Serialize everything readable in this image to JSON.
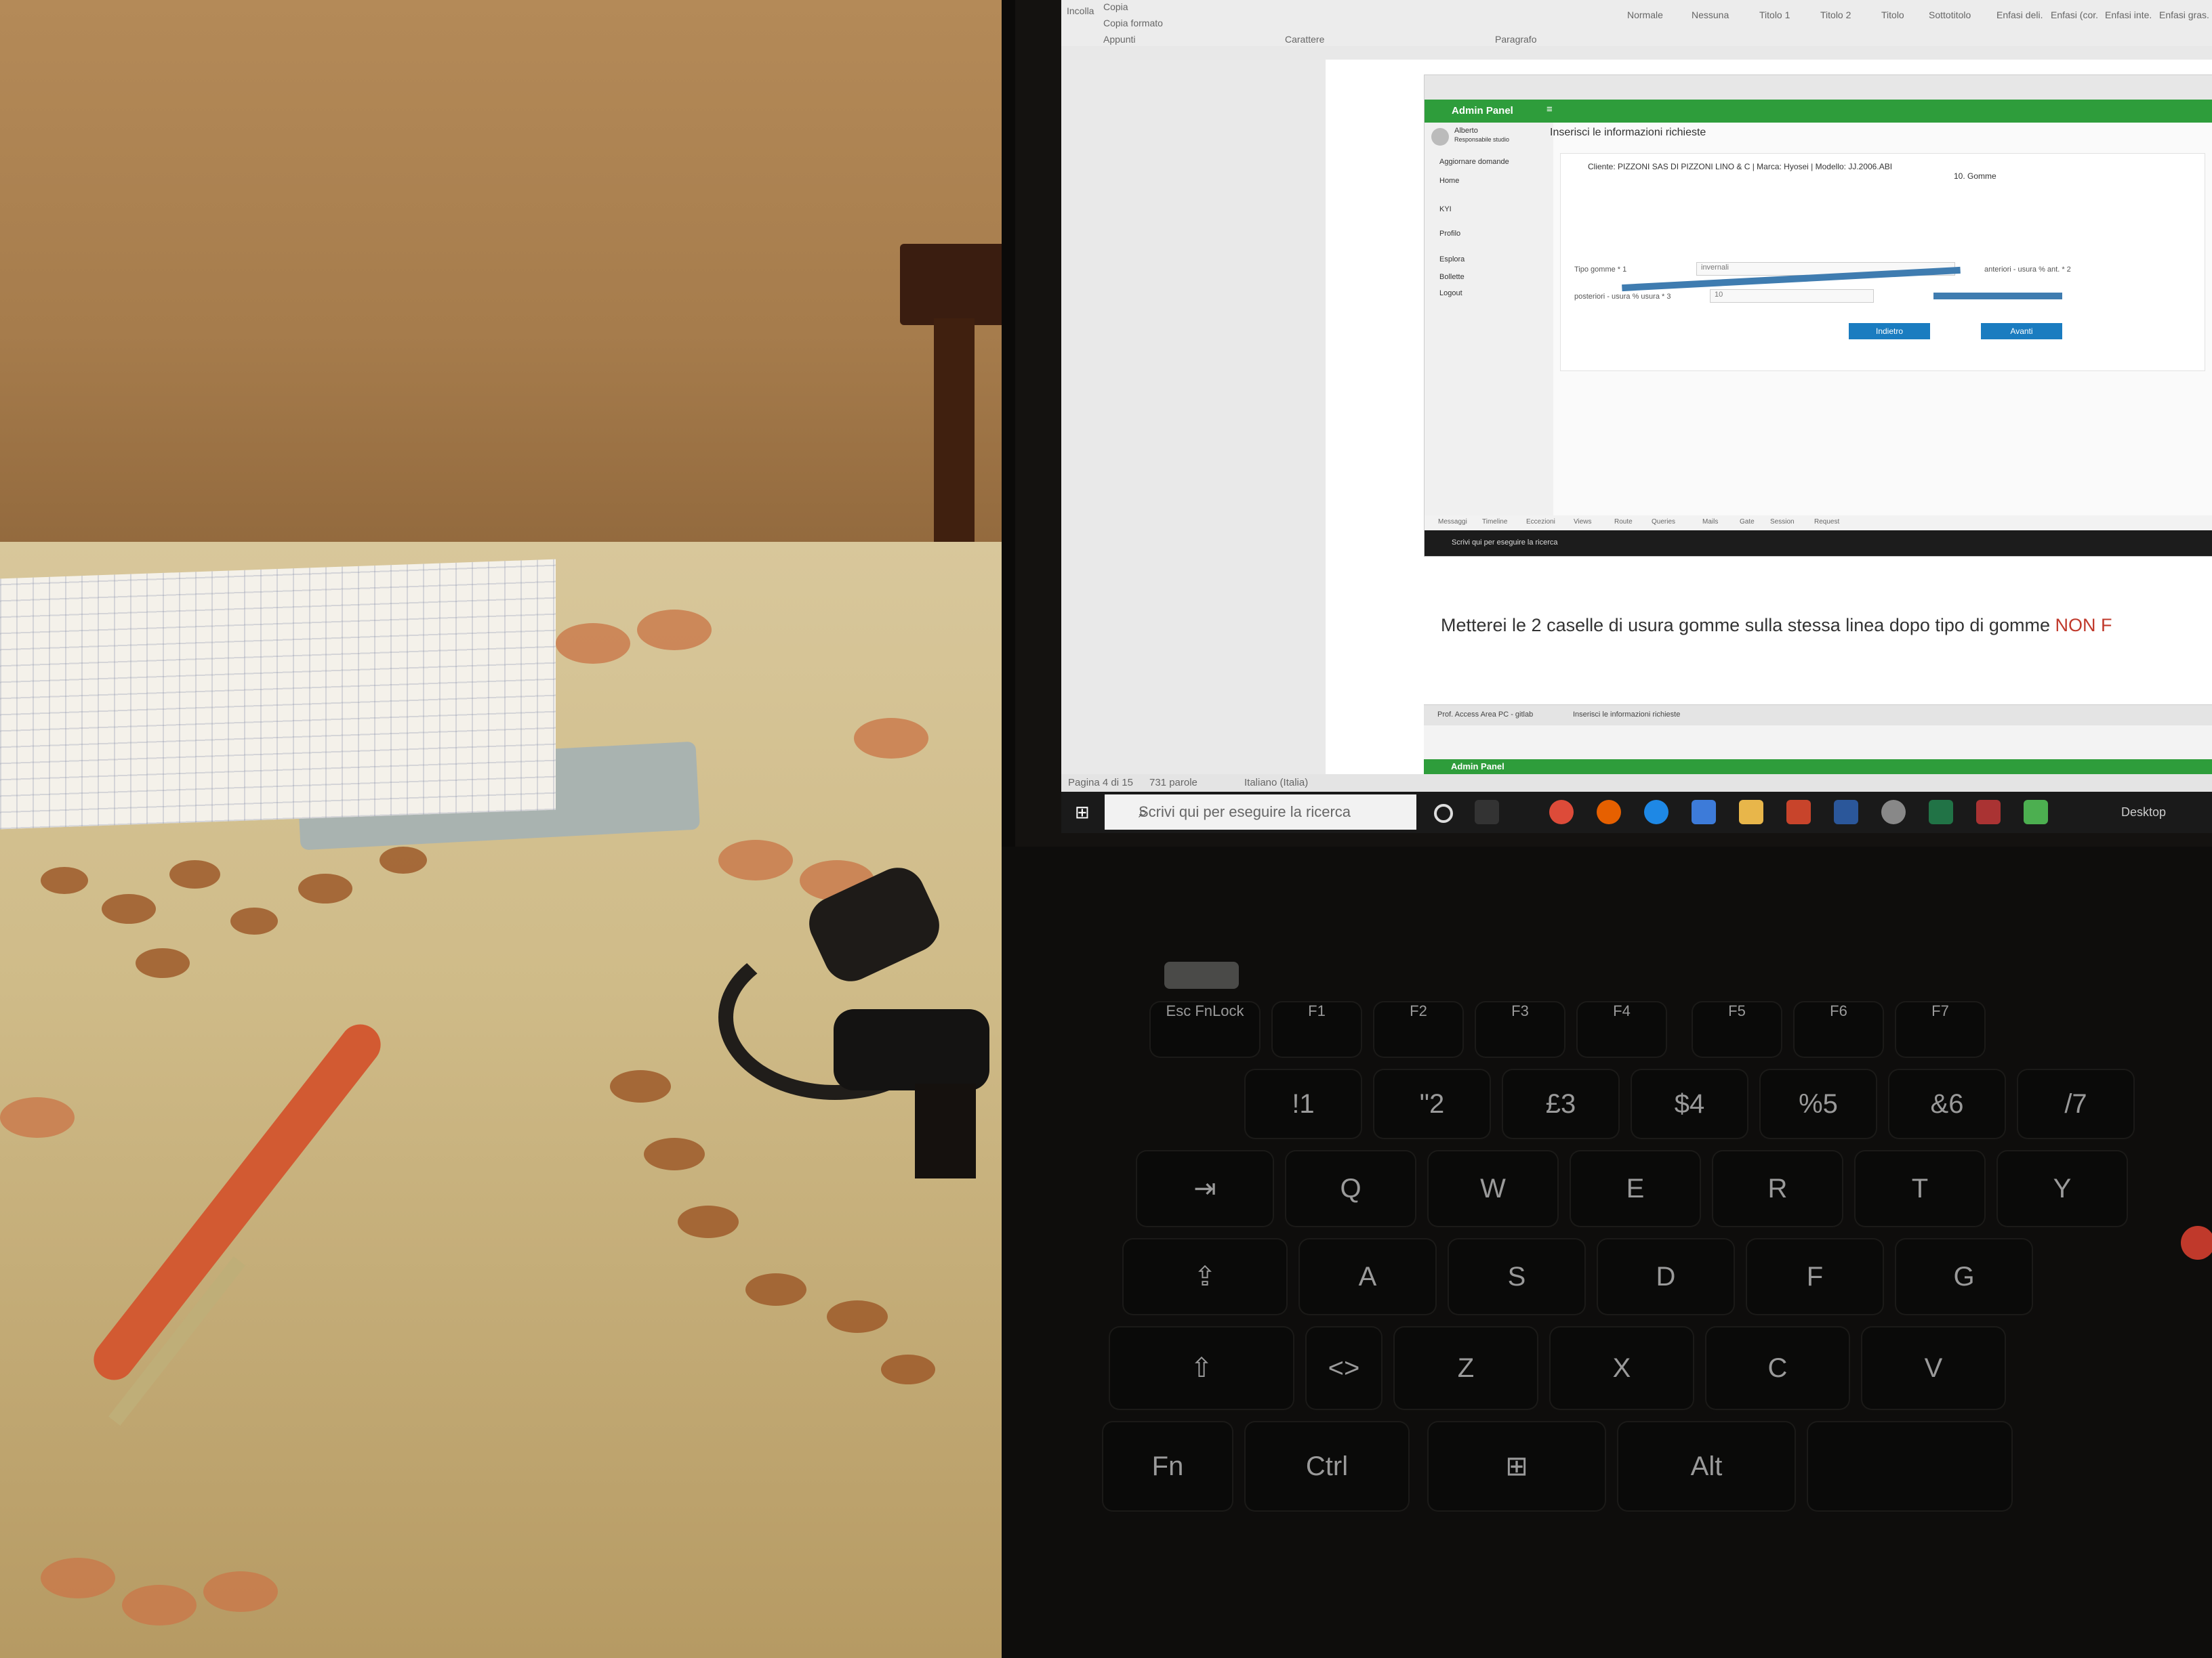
{
  "photo": {
    "laptop_screen": {
      "word": {
        "ribbon": {
          "paste_label": "Incolla",
          "copy_label": "Copia",
          "format_painter_label": "Copia formato",
          "group_clipboard": "Appunti",
          "group_font": "Carattere",
          "group_paragraph": "Paragrafo",
          "styles": [
            "Normale",
            "Nessuna",
            "Titolo 1",
            "Titolo 2",
            "Titolo",
            "Sottotitolo",
            "Enfasi deli.",
            "Enfasi (cor.",
            "Enfasi inte.",
            "Enfasi gras."
          ]
        },
        "statusbar": {
          "page": "Pagina 4 di 15",
          "words": "731 parole",
          "language": "Italiano (Italia)"
        },
        "paragraph_text": "Metterei le 2 caselle di usura gomme sulla stessa linea dopo tipo di gomme",
        "paragraph_text_red": "NON F"
      },
      "embedded_screenshot": {
        "header_title": "Admin Panel",
        "user_name": "Alberto",
        "user_role": "Responsabile studio",
        "sidebar": [
          "Aggiornare domande",
          "Home",
          "KYI",
          "Profilo",
          "Esplora",
          "Bollette",
          "Logout"
        ],
        "heading": "Inserisci le informazioni richieste",
        "client_line": "Cliente: PIZZONI SAS DI PIZZONI LINO & C | Marca: Hyosei | Modello: JJ.2006.ABI",
        "section": "10. Gomme",
        "field1_label": "Tipo gomme * 1",
        "field1_value": "invernali",
        "field1_right": "anteriori - usura % ant. * 2",
        "field2_label": "posteriori - usura % usura * 3",
        "field2_value": "10",
        "btn_back": "Indietro",
        "btn_next": "Avanti",
        "bottom_bar": [
          "Messaggi",
          "Timeline",
          "Eccezioni",
          "Views",
          "Route",
          "Queries",
          "Mails",
          "Gate",
          "Session",
          "Request"
        ],
        "search_text": "Scrivi qui per eseguire la ricerca"
      },
      "second_screenshot": {
        "tabs": [
          "Prof. Access Area PC - gitlab",
          "Inserisci le informazioni richieste"
        ],
        "header_title": "Admin Panel"
      },
      "taskbar": {
        "search_placeholder": "Scrivi qui per eseguire la ricerca",
        "desktop_label": "Desktop"
      }
    },
    "keyboard": {
      "row_fn": [
        "Esc FnLock",
        "F1",
        "F2",
        "F3",
        "F4",
        "F5",
        "F6",
        "F7"
      ],
      "row_num": [
        "!1",
        "\"2",
        "£3",
        "$4",
        "%5",
        "&6",
        "/7"
      ],
      "row_q": [
        "Q",
        "W",
        "E",
        "R",
        "T",
        "Y"
      ],
      "row_a": [
        "A",
        "S",
        "D",
        "F",
        "G"
      ],
      "row_z": [
        "Z",
        "X",
        "C",
        "V"
      ],
      "row_bottom": [
        "Fn",
        "Ctrl",
        "Alt"
      ]
    },
    "colors": {
      "admin_green": "#2e9d3b",
      "button_blue": "#1a7cc0",
      "arrow_blue": "#3f7cb0",
      "red_text": "#c0392b"
    }
  }
}
